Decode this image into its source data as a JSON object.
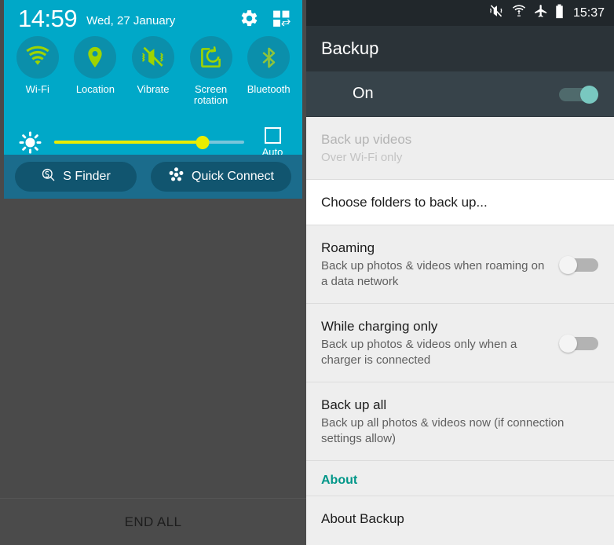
{
  "left_panel": {
    "name": "quick-settings-shade",
    "status": {
      "time": "14:59",
      "date": "Wed, 27 January",
      "settings_icon": "gear-icon",
      "edit_icon": "quick-settings-edit-icon"
    },
    "toggles": [
      {
        "label": "Wi-Fi",
        "icon": "wifi-icon",
        "state": "on"
      },
      {
        "label": "Location",
        "icon": "location-pin-icon",
        "state": "on"
      },
      {
        "label": "Vibrate",
        "icon": "vibrate-mute-icon",
        "state": "on"
      },
      {
        "label": "Screen\nrotation",
        "label_line1": "Screen",
        "label_line2": "rotation",
        "icon": "screen-rotation-icon",
        "state": "on"
      },
      {
        "label": "Bluetooth",
        "icon": "bluetooth-icon",
        "state": "on"
      }
    ],
    "brightness": {
      "icon": "brightness-sun-icon",
      "value_percent": 78,
      "auto_label": "Auto",
      "auto_checked": false
    },
    "actions": [
      {
        "label": "S Finder",
        "icon": "s-finder-search-icon"
      },
      {
        "label": "Quick Connect",
        "icon": "quick-connect-icon"
      }
    ],
    "end_all_label": "END ALL"
  },
  "right_panel": {
    "name": "backup-settings",
    "status": {
      "clock": "15:37",
      "icons": [
        "vibrate-mute-icon",
        "wifi-transfer-icon",
        "airplane-mode-icon",
        "battery-icon"
      ]
    },
    "title": "Backup",
    "master": {
      "label": "On",
      "enabled": true
    },
    "rows": [
      {
        "id": "back-up-videos",
        "title": "Back up videos",
        "subtitle": "Over Wi-Fi only",
        "disabled": true,
        "background": "grey",
        "has_toggle": false
      },
      {
        "id": "choose-folders",
        "title": "Choose folders to back up...",
        "subtitle": "",
        "disabled": false,
        "background": "white",
        "has_toggle": false
      },
      {
        "id": "roaming",
        "title": "Roaming",
        "subtitle": "Back up photos & videos when roaming on a data network",
        "disabled": false,
        "background": "grey",
        "has_toggle": true,
        "toggle_on": false
      },
      {
        "id": "while-charging-only",
        "title": "While charging only",
        "subtitle": "Back up photos & videos only when a charger is connected",
        "disabled": false,
        "background": "grey",
        "has_toggle": true,
        "toggle_on": false
      },
      {
        "id": "back-up-all",
        "title": "Back up all",
        "subtitle": "Back up all photos & videos now (if connection settings allow)",
        "disabled": false,
        "background": "grey",
        "has_toggle": false
      }
    ],
    "section_about_label": "About",
    "about_row": {
      "id": "about-backup",
      "title": "About Backup"
    }
  },
  "colors": {
    "quick_panel_bg": "#00a8c8",
    "quick_circle": "#0b8fab",
    "accent_green": "#9ed400",
    "slider_yellow": "#e9ed00",
    "action_bar": "#1b6c8c",
    "teal_accent": "#009688",
    "toggle_on_knob": "#79c8c0",
    "dim_overlay": "#4a4a4a"
  }
}
